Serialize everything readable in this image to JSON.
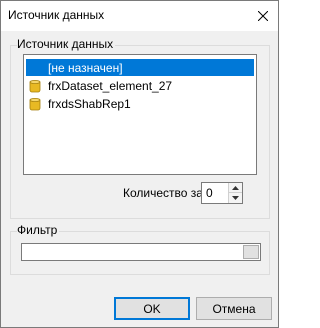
{
  "window": {
    "title": "Источник данных"
  },
  "groups": {
    "source_label": "Источник данных",
    "filter_label": "Фильтр"
  },
  "list": {
    "items": [
      {
        "label": "[не назначен]",
        "selected": true,
        "icon": "none"
      },
      {
        "label": "frxDataset_element_27",
        "selected": false,
        "icon": "database-icon"
      },
      {
        "label": "frxdsShabRep1",
        "selected": false,
        "icon": "database-icon"
      }
    ]
  },
  "record_count": {
    "label": "Количество записей:",
    "value": "0"
  },
  "filter": {
    "value": ""
  },
  "buttons": {
    "ok": "OK",
    "cancel": "Отмена"
  },
  "colors": {
    "selection": "#0078d7",
    "db_icon": "#e8b923"
  }
}
